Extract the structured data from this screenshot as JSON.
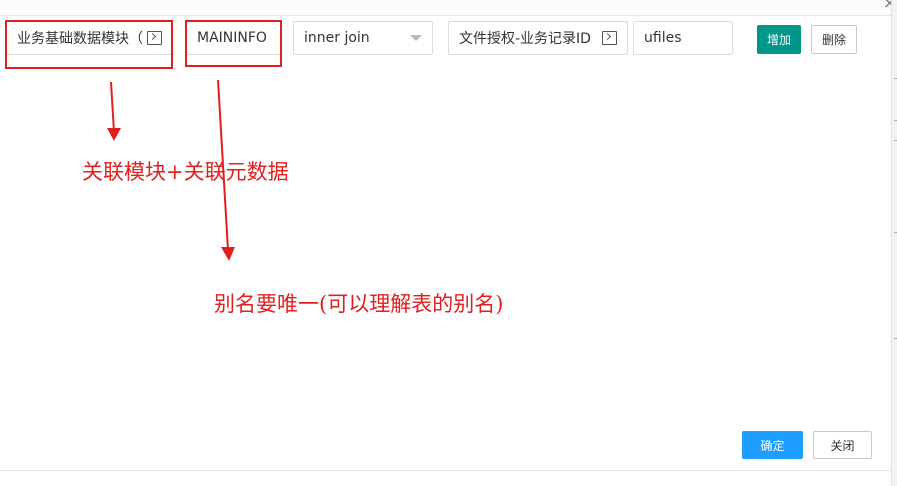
{
  "form": {
    "module_field": "业务基础数据模块（勿",
    "alias_field": "MAININFO",
    "join_type": "inner join",
    "target_field": "文件授权-业务记录ID",
    "target_alias": "ufiles"
  },
  "buttons": {
    "add": "增加",
    "delete": "删除",
    "confirm": "确定",
    "close": "关闭"
  },
  "annotations": {
    "note_module": "关联模块+关联元数据",
    "note_alias": "别名要唯一(可以理解表的别名)"
  },
  "colors": {
    "annotation_red": "#e02020",
    "add_button": "#009688",
    "confirm_button": "#1e9fff"
  },
  "icons": {
    "picker": "picker-icon",
    "dropdown": "chevron-down-icon",
    "close": "close-icon"
  }
}
